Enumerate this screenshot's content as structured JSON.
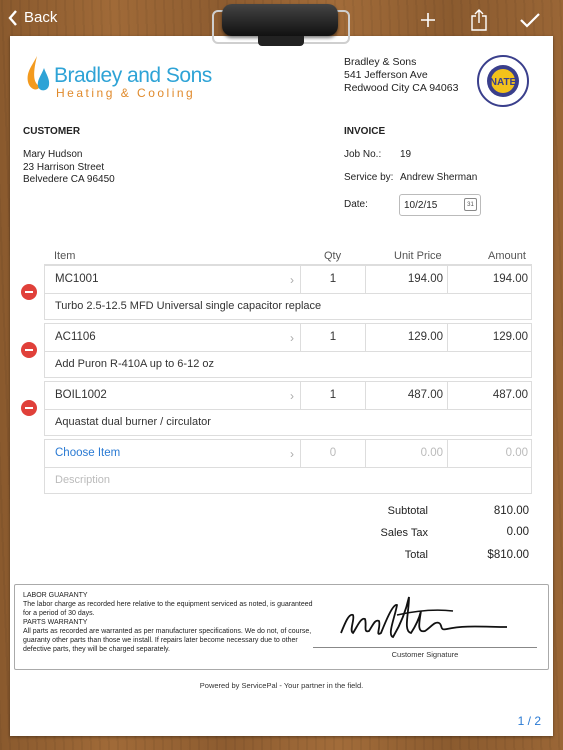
{
  "nav": {
    "back_label": "Back",
    "icons": [
      "add-icon",
      "share-icon",
      "checkmark-icon"
    ]
  },
  "company": {
    "name": "Bradley and Sons",
    "tagline": "Heating & Cooling",
    "address_name": "Bradley & Sons",
    "address_line1": "541 Jefferson Ave",
    "address_line2": "Redwood City CA 94063",
    "badge_text": "NATE"
  },
  "customer": {
    "heading": "CUSTOMER",
    "name": "Mary Hudson",
    "street": "23 Harrison Street",
    "city": "Belvedere CA 96450"
  },
  "invoice": {
    "heading": "INVOICE",
    "job_label": "Job No.:",
    "job_value": "19",
    "service_label": "Service by:",
    "service_value": "Andrew Sherman",
    "date_label": "Date:",
    "date_value": "10/2/15",
    "calendar_day": "31"
  },
  "table": {
    "headers": {
      "item": "Item",
      "qty": "Qty",
      "unit_price": "Unit Price",
      "amount": "Amount"
    },
    "rows": [
      {
        "item": "MC1001",
        "qty": "1",
        "price": "194.00",
        "amount": "194.00",
        "desc": "Turbo 2.5-12.5 MFD Universal single capacitor replace"
      },
      {
        "item": "AC1106",
        "qty": "1",
        "price": "129.00",
        "amount": "129.00",
        "desc": "Add Puron R-410A up to 6-12 oz"
      },
      {
        "item": "BOIL1002",
        "qty": "1",
        "price": "487.00",
        "amount": "487.00",
        "desc": "Aquastat dual burner / circulator"
      }
    ],
    "new_row": {
      "item": "Choose Item",
      "qty": "0",
      "price": "0.00",
      "amount": "0.00",
      "desc": "Description"
    }
  },
  "totals": {
    "subtotal_label": "Subtotal",
    "subtotal_value": "810.00",
    "tax_label": "Sales Tax",
    "tax_value": "0.00",
    "total_label": "Total",
    "total_value": "$810.00"
  },
  "guarantee": {
    "labor_title": "LABOR GUARANTY",
    "labor_text": "The labor charge as recorded here relative to the equipment serviced as noted, is guaranteed for a period of 30 days.",
    "parts_title": "PARTS WARRANTY",
    "parts_text": "All parts as recorded are warranted as per manufacturer specifications. We do not, of course, guaranty other parts than those we install. If repairs later become necessary due to other defective parts, they will be charged separately.",
    "signature_label": "Customer Signature"
  },
  "footer": {
    "powered_by": "Powered by ServicePal - Your partner in the field.",
    "page": "1 / 2"
  },
  "colors": {
    "accent": "#2a7ad3",
    "remove": "#e0403a",
    "brand_blue": "#2ea3d6",
    "brand_orange": "#e08a2c"
  }
}
